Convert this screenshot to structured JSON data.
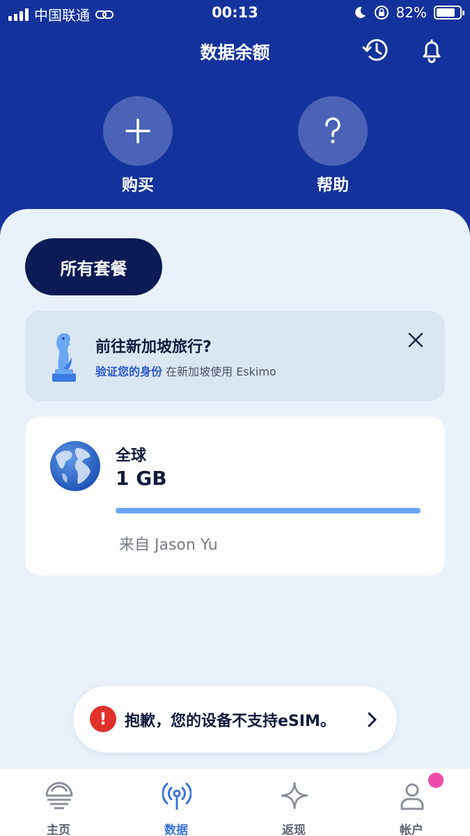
{
  "status_bar": {
    "carrier": "中国联通",
    "time": "00:13",
    "battery_percent": "82%",
    "battery_level": 0.82
  },
  "header": {
    "title": "数据余额",
    "actions": [
      {
        "label": "购买",
        "icon": "plus-icon"
      },
      {
        "label": "帮助",
        "icon": "question-icon"
      }
    ]
  },
  "filter": {
    "all_plans_label": "所有套餐"
  },
  "promo": {
    "title": "前往新加坡旅行?",
    "link_text": "验证您的身份",
    "subtitle_rest": " 在新加坡使用 Eskimo"
  },
  "plan": {
    "region": "全球",
    "amount": "1 GB",
    "remaining_fraction": 1.0,
    "from": "来自 Jason Yu"
  },
  "toast": {
    "icon": "!",
    "text": "抱歉，您的设备不支持eSIM。"
  },
  "nav": {
    "items": [
      {
        "label": "主页",
        "icon": "home-icon"
      },
      {
        "label": "数据",
        "icon": "data-signal-icon",
        "active": true
      },
      {
        "label": "返现",
        "icon": "sparkle-icon"
      },
      {
        "label": "帐户",
        "icon": "account-icon",
        "badge": true
      }
    ]
  },
  "colors": {
    "header_bg": "#14329b",
    "accent": "#3a74d8",
    "progress": "#6aa6f4",
    "error": "#e0312b",
    "badge": "#ec4aa8"
  }
}
